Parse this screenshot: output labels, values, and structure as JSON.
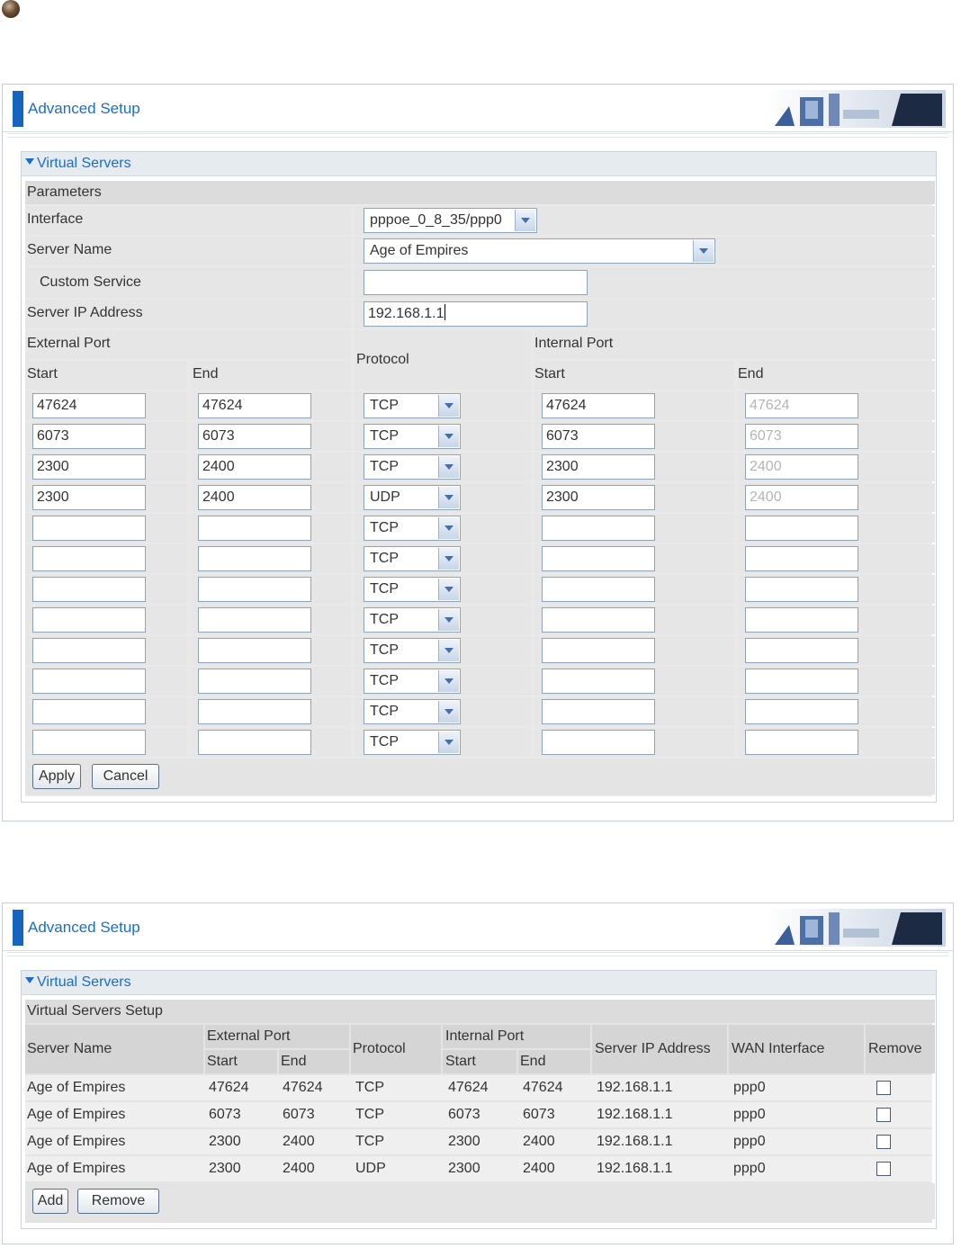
{
  "header": {
    "title": "Advanced Setup"
  },
  "form": {
    "section_title": "Virtual Servers",
    "params_label": "Parameters",
    "interface_label": "Interface",
    "interface_value": "pppoe_0_8_35/ppp0",
    "server_name_label": "Server Name",
    "server_name_value": "Age of Empires",
    "custom_service_label": "Custom Service",
    "custom_service_value": "",
    "server_ip_label": "Server IP Address",
    "server_ip_value": "192.168.1.1",
    "external_port_label": "External Port",
    "internal_port_label": "Internal Port",
    "protocol_label": "Protocol",
    "start_label": "Start",
    "end_label": "End",
    "rows": [
      {
        "ext_start": "47624",
        "ext_end": "47624",
        "protocol": "TCP",
        "int_start": "47624",
        "int_end": "47624"
      },
      {
        "ext_start": "6073",
        "ext_end": "6073",
        "protocol": "TCP",
        "int_start": "6073",
        "int_end": "6073"
      },
      {
        "ext_start": "2300",
        "ext_end": "2400",
        "protocol": "TCP",
        "int_start": "2300",
        "int_end": "2400"
      },
      {
        "ext_start": "2300",
        "ext_end": "2400",
        "protocol": "UDP",
        "int_start": "2300",
        "int_end": "2400"
      },
      {
        "ext_start": "",
        "ext_end": "",
        "protocol": "TCP",
        "int_start": "",
        "int_end": ""
      },
      {
        "ext_start": "",
        "ext_end": "",
        "protocol": "TCP",
        "int_start": "",
        "int_end": ""
      },
      {
        "ext_start": "",
        "ext_end": "",
        "protocol": "TCP",
        "int_start": "",
        "int_end": ""
      },
      {
        "ext_start": "",
        "ext_end": "",
        "protocol": "TCP",
        "int_start": "",
        "int_end": ""
      },
      {
        "ext_start": "",
        "ext_end": "",
        "protocol": "TCP",
        "int_start": "",
        "int_end": ""
      },
      {
        "ext_start": "",
        "ext_end": "",
        "protocol": "TCP",
        "int_start": "",
        "int_end": ""
      },
      {
        "ext_start": "",
        "ext_end": "",
        "protocol": "TCP",
        "int_start": "",
        "int_end": ""
      },
      {
        "ext_start": "",
        "ext_end": "",
        "protocol": "TCP",
        "int_start": "",
        "int_end": ""
      }
    ],
    "apply_label": "Apply",
    "cancel_label": "Cancel"
  },
  "list": {
    "section_title": "Virtual Servers",
    "setup_label": "Virtual Servers Setup",
    "headers": {
      "server_name": "Server Name",
      "external_port": "External Port",
      "start": "Start",
      "end": "End",
      "protocol": "Protocol",
      "internal_port": "Internal Port",
      "server_ip": "Server IP Address",
      "wan_interface": "WAN Interface",
      "remove": "Remove"
    },
    "rows": [
      {
        "name": "Age of Empires",
        "ext_start": "47624",
        "ext_end": "47624",
        "protocol": "TCP",
        "int_start": "47624",
        "int_end": "47624",
        "ip": "192.168.1.1",
        "wan": "ppp0"
      },
      {
        "name": "Age of Empires",
        "ext_start": "6073",
        "ext_end": "6073",
        "protocol": "TCP",
        "int_start": "6073",
        "int_end": "6073",
        "ip": "192.168.1.1",
        "wan": "ppp0"
      },
      {
        "name": "Age of Empires",
        "ext_start": "2300",
        "ext_end": "2400",
        "protocol": "TCP",
        "int_start": "2300",
        "int_end": "2400",
        "ip": "192.168.1.1",
        "wan": "ppp0"
      },
      {
        "name": "Age of Empires",
        "ext_start": "2300",
        "ext_end": "2400",
        "protocol": "UDP",
        "int_start": "2300",
        "int_end": "2400",
        "ip": "192.168.1.1",
        "wan": "ppp0"
      }
    ],
    "add_label": "Add",
    "remove_label": "Remove"
  },
  "colors": {
    "accent": "#1a6fc4",
    "bar": "#1565c0",
    "panel_bg": "#e6e6e6"
  }
}
